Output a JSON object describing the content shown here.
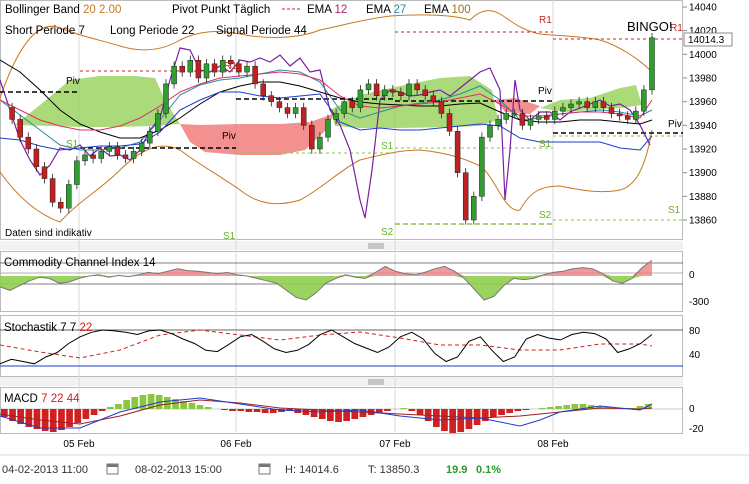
{
  "indicators": {
    "bollinger": {
      "label": "Bollinger Band",
      "p1": "20",
      "p2": "2.00",
      "color": "#c87820"
    },
    "pivot": {
      "label": "Pivot Punkt",
      "period": "Täglich",
      "color": "#d02020"
    },
    "ema12": {
      "label": "EMA",
      "value": "12",
      "color": "#b0206e"
    },
    "ema27": {
      "label": "EMA",
      "value": "27",
      "color": "#2a8aa0"
    },
    "ema100": {
      "label": "EMA",
      "value": "100",
      "color": "#a07020"
    },
    "short": {
      "label": "Short Periode",
      "value": "7"
    },
    "long": {
      "label": "Long Periode",
      "value": "22"
    },
    "signal": {
      "label": "Signal Periode",
      "value": "44"
    }
  },
  "annotations": {
    "bingo": "BINGO!",
    "indicative": "Daten sind indikativ",
    "current_price": "14014.3",
    "pivot_labels": {
      "piv1": "Piv",
      "piv2": "Piv",
      "piv3": "Piv",
      "piv4": "Piv",
      "r1a": "R1",
      "r1b": "R1",
      "r1c": "R1",
      "s1a": "S1",
      "s1b": "S1",
      "s1c": "S1",
      "s1d": "S1",
      "s1e": "S1",
      "s2a": "S2",
      "s2b": "S2"
    }
  },
  "panels": {
    "cci": {
      "label": "Commodity Channel Index",
      "param": "14"
    },
    "stoch": {
      "label": "Stochastik",
      "p1": "7",
      "p2": "7",
      "p3": "22"
    },
    "macd": {
      "label": "MACD",
      "p1": "7",
      "p2": "22",
      "p3": "44"
    }
  },
  "footer": {
    "start": "04-02-2013 11:00",
    "end": "08-02-2013 15:00",
    "high_label": "H:",
    "high": "14014.6",
    "low_label": "T:",
    "low": "13850.3",
    "change": "19.9",
    "change_pct": "0.1%"
  },
  "chart_data": [
    {
      "type": "candlestick",
      "title": "",
      "x_ticks": [
        "05 Feb",
        "06 Feb",
        "07 Feb",
        "08 Feb"
      ],
      "y_ticks": [
        13860,
        13880,
        13900,
        13920,
        13940,
        13960,
        13980,
        14000,
        14020,
        14040
      ],
      "ylim": [
        13845,
        14045
      ],
      "current_price": 14014.3,
      "high": 14014.6,
      "low": 13850.3,
      "close_series": [
        13955,
        13945,
        13930,
        13920,
        13905,
        13895,
        13875,
        13870,
        13890,
        13910,
        13915,
        13912,
        13918,
        13922,
        13915,
        13912,
        13918,
        13925,
        13935,
        13950,
        13975,
        13990,
        13985,
        13995,
        13980,
        13992,
        13985,
        13995,
        13992,
        13985,
        13990,
        13975,
        13965,
        13960,
        13955,
        13950,
        13955,
        13940,
        13920,
        13930,
        13945,
        13950,
        13960,
        13955,
        13970,
        13975,
        13965,
        13970,
        13968,
        13965,
        13975,
        13970,
        13965,
        13960,
        13950,
        13935,
        13900,
        13860,
        13880,
        13930,
        13940,
        13945,
        13950,
        13950,
        13940,
        13945,
        13948,
        13945,
        13952,
        13955,
        13958,
        13960,
        13955,
        13960,
        13955,
        13950,
        13948,
        13945,
        13952,
        13970,
        14014
      ]
    },
    {
      "type": "line",
      "title": "Commodity Channel Index",
      "y_ticks": [
        -300,
        0
      ],
      "series": [
        {
          "name": "CCI",
          "values": [
            -90,
            -120,
            -80,
            -40,
            -10,
            -20,
            -60,
            -50,
            -20,
            0,
            10,
            -10,
            5,
            -5,
            10,
            30,
            20,
            40,
            60,
            45,
            40,
            30,
            20,
            30,
            10,
            0,
            -20,
            -40,
            -60,
            -120,
            -180,
            -200,
            -140,
            -60,
            -20,
            10,
            -10,
            -20,
            30,
            80,
            40,
            20,
            10,
            30,
            60,
            80,
            40,
            -20,
            -110,
            -200,
            -170,
            -80,
            -20,
            -30,
            -20,
            10,
            30,
            40,
            60,
            70,
            60,
            20,
            -40,
            -60,
            -20,
            70,
            130
          ]
        }
      ]
    },
    {
      "type": "line",
      "title": "Stochastik",
      "y_ticks": [
        40,
        80
      ],
      "series": [
        {
          "name": "%K",
          "values": [
            5,
            15,
            10,
            5,
            20,
            30,
            50,
            65,
            75,
            80,
            78,
            75,
            70,
            78,
            80,
            72,
            60,
            50,
            35,
            32,
            48,
            65,
            70,
            55,
            38,
            30,
            35,
            48,
            70,
            80,
            65,
            50,
            40,
            30,
            42,
            65,
            75,
            60,
            28,
            10,
            20,
            55,
            65,
            35,
            10,
            20,
            60,
            70,
            62,
            58,
            70,
            75,
            72,
            60,
            30,
            38,
            50,
            70
          ]
        }
      ]
    },
    {
      "type": "bar",
      "title": "MACD",
      "y_ticks": [
        -20,
        0
      ],
      "series": [
        {
          "name": "MACD",
          "values": [
            -8,
            -12,
            -15,
            -18,
            -20,
            -22,
            -23,
            -21,
            -18,
            -14,
            -10,
            -6,
            -2,
            2,
            5,
            9,
            12,
            14,
            15,
            14,
            12,
            10,
            8,
            6,
            4,
            2,
            0,
            -1,
            -2,
            -2,
            -3,
            -3,
            -4,
            -4,
            -3,
            -2,
            -4,
            -6,
            -8,
            -10,
            -12,
            -13,
            -12,
            -10,
            -8,
            -6,
            -4,
            -2,
            0,
            1,
            -2,
            -6,
            -12,
            -18,
            -22,
            -24,
            -23,
            -20,
            -16,
            -12,
            -8,
            -6,
            -4,
            -2,
            -1,
            0,
            1,
            2,
            3,
            4,
            5,
            5,
            4,
            3,
            2,
            1,
            0,
            1,
            3,
            5
          ]
        }
      ]
    }
  ]
}
